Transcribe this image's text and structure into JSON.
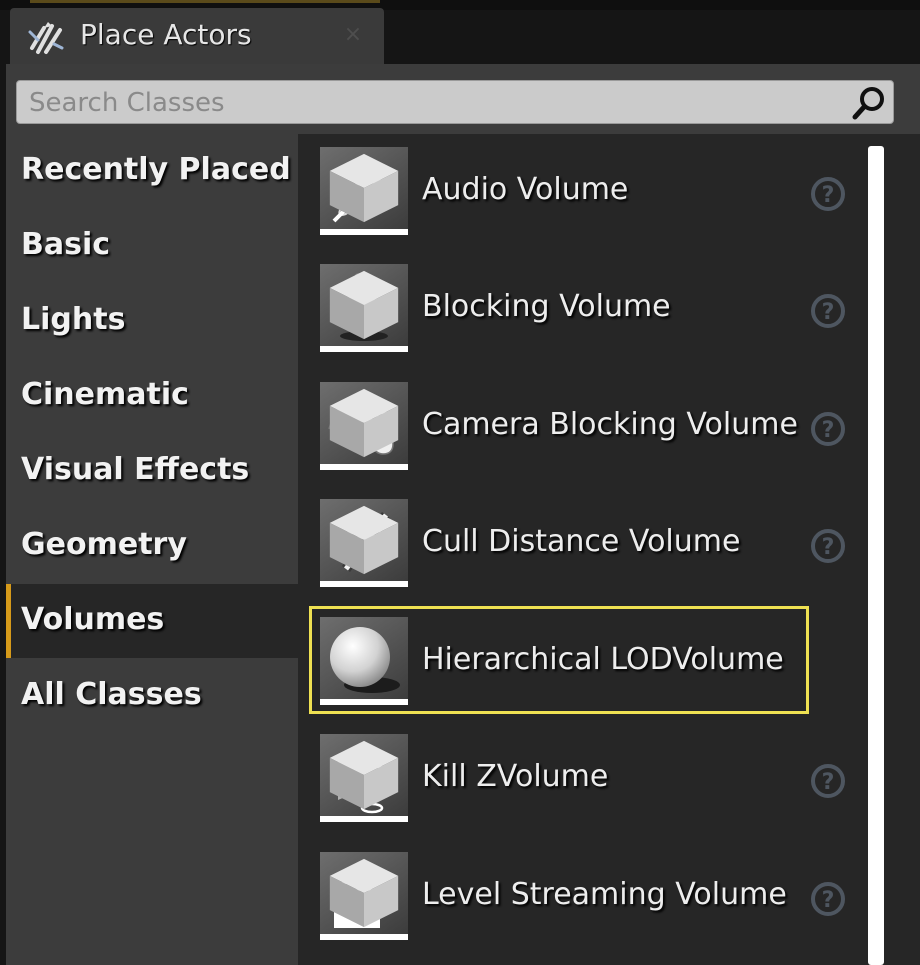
{
  "tab": {
    "title": "Place Actors",
    "close_symbol": "×"
  },
  "search": {
    "placeholder": "Search Classes",
    "value": ""
  },
  "categories": [
    {
      "label": "Recently Placed",
      "active": false
    },
    {
      "label": "Basic",
      "active": false
    },
    {
      "label": "Lights",
      "active": false
    },
    {
      "label": "Cinematic",
      "active": false
    },
    {
      "label": "Visual Effects",
      "active": false
    },
    {
      "label": "Geometry",
      "active": false
    },
    {
      "label": "Volumes",
      "active": true
    },
    {
      "label": "All Classes",
      "active": false
    }
  ],
  "items": [
    {
      "label": "Audio Volume",
      "icon": "audio-volume-icon",
      "help": true,
      "selected": false
    },
    {
      "label": "Blocking Volume",
      "icon": "blocking-volume-icon",
      "help": true,
      "selected": false
    },
    {
      "label": "Camera Blocking Volume",
      "icon": "camera-blocking-volume-icon",
      "help": true,
      "selected": false
    },
    {
      "label": "Cull Distance Volume",
      "icon": "cull-distance-volume-icon",
      "help": true,
      "selected": false
    },
    {
      "label": "Hierarchical LODVolume",
      "icon": "sphere-icon",
      "help": false,
      "selected": true
    },
    {
      "label": "Kill ZVolume",
      "icon": "kill-z-volume-icon",
      "help": true,
      "selected": false
    },
    {
      "label": "Level Streaming Volume",
      "icon": "level-streaming-volume-icon",
      "help": true,
      "selected": false
    }
  ],
  "colors": {
    "accent": "#d69a1a",
    "highlight": "#efe152",
    "panel": "#3c3c3c",
    "list": "#262626"
  }
}
